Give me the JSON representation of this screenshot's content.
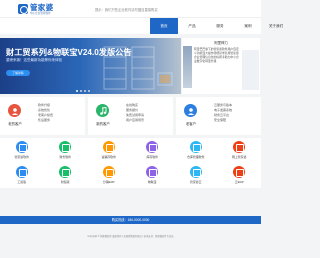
{
  "header": {
    "logo_title": "管家婆",
    "logo_badge": "36",
    "logo_sub": "中小企业管理软件",
    "notice": "提示：我们只售企业软件请勿擅自直接购买"
  },
  "nav": {
    "items": [
      {
        "label": "首页",
        "active": true
      },
      {
        "label": "产品",
        "active": false
      },
      {
        "label": "服务",
        "active": false
      },
      {
        "label": "案例",
        "active": false
      },
      {
        "label": "关于我们",
        "active": false
      }
    ]
  },
  "banner": {
    "title": "财工贸系列&物联宝V24.0发版公告",
    "subtitle": "重磅来袭！这些最新功能等你来体验",
    "button": "了解详情",
    "dots": 4
  },
  "news": {
    "title": "阿里神力",
    "text": "阿里巴巴旗下的管家婆软件用户自定义功能强大操作简便易学易用管家婆企业管理信息化的好帮手助力中小企业数字化转型升级"
  },
  "cards": [
    {
      "label": "老的客户",
      "icon": "user-icon",
      "color": "#e8553e",
      "items": [
        "软件升级",
        "系统优化",
        "老客户续费",
        "售后服务"
      ]
    },
    {
      "label": "新的客户",
      "icon": "music-icon",
      "color": "#2bb56b",
      "items": [
        "在线购买",
        "服务报价",
        "免费试用申请",
        "用户应用场景"
      ]
    },
    {
      "label": "老客户",
      "icon": "user-icon",
      "color": "#2c7fe0",
      "items": [
        "云服务与版本",
        "电子发票系统",
        "财务云平台",
        "安全保障"
      ]
    }
  ],
  "grid": [
    {
      "label": "管家婆软件",
      "color": "#2d8cf0"
    },
    {
      "label": "财务软件",
      "color": "#19be6b"
    },
    {
      "label": "进销存软件",
      "color": "#ff9900"
    },
    {
      "label": "库存软件",
      "color": "#8e62e6"
    },
    {
      "label": "仓库管理软件",
      "color": "#2db7f5"
    },
    {
      "label": "网上管家婆",
      "color": "#ed4014"
    },
    {
      "label": "工贸版",
      "color": "#2d8cf0"
    },
    {
      "label": "财贸版",
      "color": "#19be6b"
    },
    {
      "label": "分销ERP",
      "color": "#ff9900"
    },
    {
      "label": "物联宝",
      "color": "#8e62e6"
    },
    {
      "label": "管家婆云",
      "color": "#2db7f5"
    },
    {
      "label": "云ERP",
      "color": "#ed4014"
    }
  ],
  "hotline": "购买热线：186-0000-0000",
  "footer": "Copyright © 管家婆软件 版权所有 | 全国销售服务网点 | 技术支持：管家婆软件专卖店"
}
